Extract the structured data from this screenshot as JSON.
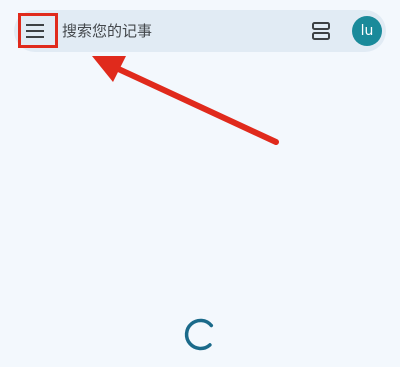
{
  "search": {
    "placeholder": "搜索您的记事"
  },
  "account": {
    "initials": "lu",
    "color": "#1a8a9a"
  },
  "icons": {
    "menu": "hamburger-menu-icon",
    "view_toggle": "list-view-icon",
    "loading": "loading-spinner-icon"
  },
  "annotation": {
    "color": "#e02a1c"
  }
}
